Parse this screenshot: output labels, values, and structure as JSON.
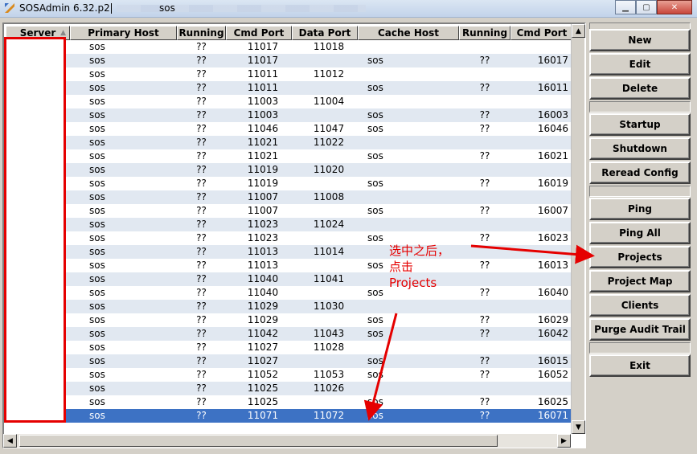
{
  "window": {
    "title": "SOSAdmin 6.32.p2",
    "title_suffix": "sos"
  },
  "table": {
    "headers": [
      "Server",
      "Primary Host",
      "Running",
      "Cmd Port",
      "Data Port",
      "Cache Host",
      "Running",
      "Cmd Port"
    ],
    "rows": [
      [
        "",
        "sos",
        "??",
        "11017",
        "11018",
        "",
        "",
        ""
      ],
      [
        "",
        "sos",
        "??",
        "11017",
        "",
        "sos",
        "??",
        "16017"
      ],
      [
        "",
        "sos",
        "??",
        "11011",
        "11012",
        "",
        "",
        ""
      ],
      [
        "",
        "sos",
        "??",
        "11011",
        "",
        "sos",
        "??",
        "16011"
      ],
      [
        "",
        "sos",
        "??",
        "11003",
        "11004",
        "",
        "",
        ""
      ],
      [
        "",
        "sos",
        "??",
        "11003",
        "",
        "sos",
        "??",
        "16003"
      ],
      [
        "",
        "sos",
        "??",
        "11046",
        "11047",
        "sos",
        "??",
        "16046"
      ],
      [
        "",
        "sos",
        "??",
        "11021",
        "11022",
        "",
        "",
        ""
      ],
      [
        "",
        "sos",
        "??",
        "11021",
        "",
        "sos",
        "??",
        "16021"
      ],
      [
        "",
        "sos",
        "??",
        "11019",
        "11020",
        "",
        "",
        ""
      ],
      [
        "",
        "sos",
        "??",
        "11019",
        "",
        "sos",
        "??",
        "16019"
      ],
      [
        "",
        "sos",
        "??",
        "11007",
        "11008",
        "",
        "",
        ""
      ],
      [
        "",
        "sos",
        "??",
        "11007",
        "",
        "sos",
        "??",
        "16007"
      ],
      [
        "",
        "sos",
        "??",
        "11023",
        "11024",
        "",
        "",
        ""
      ],
      [
        "",
        "sos",
        "??",
        "11023",
        "",
        "sos",
        "??",
        "16023"
      ],
      [
        "",
        "sos",
        "??",
        "11013",
        "11014",
        "",
        "",
        ""
      ],
      [
        "",
        "sos",
        "??",
        "11013",
        "",
        "sos",
        "??",
        "16013"
      ],
      [
        "",
        "sos",
        "??",
        "11040",
        "11041",
        "",
        "",
        ""
      ],
      [
        "",
        "sos",
        "??",
        "11040",
        "",
        "sos",
        "??",
        "16040"
      ],
      [
        "",
        "sos",
        "??",
        "11029",
        "11030",
        "",
        "",
        ""
      ],
      [
        "",
        "sos",
        "??",
        "11029",
        "",
        "sos",
        "??",
        "16029"
      ],
      [
        "",
        "sos",
        "??",
        "11042",
        "11043",
        "sos",
        "??",
        "16042"
      ],
      [
        "",
        "sos",
        "??",
        "11027",
        "11028",
        "",
        "",
        ""
      ],
      [
        "",
        "sos",
        "??",
        "11027",
        "",
        "sos",
        "??",
        "16015"
      ],
      [
        "",
        "sos",
        "??",
        "11052",
        "11053",
        "sos",
        "??",
        "16052"
      ],
      [
        "",
        "sos",
        "??",
        "11025",
        "11026",
        "",
        "",
        ""
      ],
      [
        "",
        "sos",
        "??",
        "11025",
        "",
        "sos",
        "??",
        "16025"
      ],
      [
        "",
        "sos",
        "??",
        "11071",
        "11072",
        "sos",
        "??",
        "16071"
      ]
    ],
    "selected_row": 27
  },
  "buttons": {
    "new": "New",
    "edit": "Edit",
    "delete": "Delete",
    "startup": "Startup",
    "shutdown": "Shutdown",
    "reread_config": "Reread Config",
    "ping": "Ping",
    "ping_all": "Ping All",
    "projects": "Projects",
    "project_map": "Project Map",
    "clients": "Clients",
    "purge_audit_trail": "Purge Audit Trail",
    "exit": "Exit"
  },
  "annotation": {
    "text": "选中之后，\n点击\nProjects",
    "color": "#e50000"
  },
  "colors": {
    "selection": "#3d72c4",
    "row_alt": "#e1e8f1",
    "annotation": "#e50000"
  }
}
